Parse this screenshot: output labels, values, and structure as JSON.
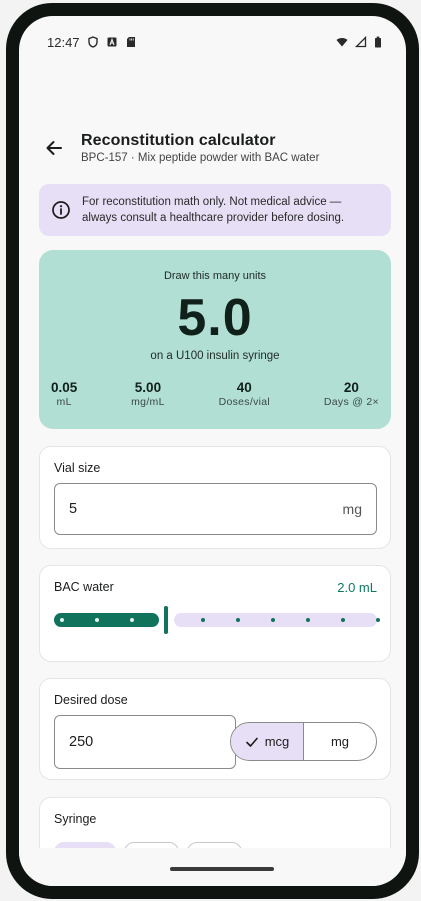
{
  "status_bar": {
    "time": "12:47",
    "icons_left": [
      "shield-icon",
      "a-box-icon",
      "sd-card-icon"
    ],
    "icons_right": [
      "wifi-icon",
      "signal-icon",
      "battery-icon"
    ]
  },
  "header": {
    "title": "Reconstitution calculator",
    "subtitle": "BPC-157 · Mix peptide powder with BAC water"
  },
  "notice": {
    "icon": "info-icon",
    "text_line1": "For reconstitution math only. Not medical advice —",
    "text_line2": "always consult a healthcare provider before dosing."
  },
  "result": {
    "heading": "Draw this many units",
    "units": "5.0",
    "syringe_note": "on a U100 insulin syringe",
    "stats": [
      {
        "value": "0.05",
        "label": "mL"
      },
      {
        "value": "5.00",
        "label": "mg/mL"
      },
      {
        "value": "40",
        "label": "Doses/vial"
      },
      {
        "value": "20",
        "label": "Days @ 2×"
      }
    ]
  },
  "vial": {
    "label": "Vial size",
    "value": "5",
    "unit": "mg"
  },
  "bac": {
    "label": "BAC water",
    "value_text": "2.0 mL",
    "value_fraction": 0.3
  },
  "dose": {
    "label": "Desired dose",
    "value": "250",
    "units": [
      {
        "label": "mcg",
        "selected": true
      },
      {
        "label": "mg",
        "selected": false
      }
    ]
  },
  "syringe": {
    "label": "Syringe"
  },
  "colors": {
    "accent": "#12735c",
    "result_bg": "#b2dfd3",
    "notice_bg": "#e6dff5",
    "bac_value": "#0e7a5f"
  }
}
